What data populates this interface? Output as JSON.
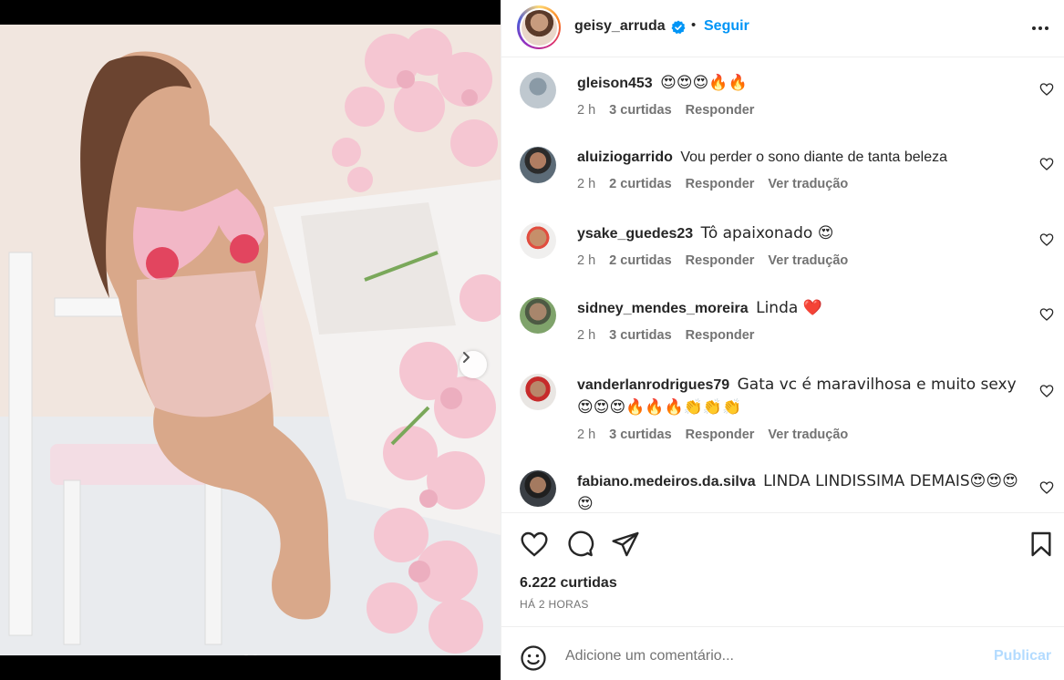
{
  "post": {
    "username": "geisy_arruda",
    "follow_label": "Seguir",
    "separator": "•",
    "likes": "6.222 curtidas",
    "time": "HÁ 2 HORAS"
  },
  "comments": [
    {
      "user": "gleison453",
      "text": "😍😍😍🔥🔥",
      "time": "2 h",
      "likes": "3 curtidas",
      "reply": "Responder",
      "translate": ""
    },
    {
      "user": "aluiziogarrido",
      "text": "Vou perder o sono diante de tanta beleza",
      "time": "2 h",
      "likes": "2 curtidas",
      "reply": "Responder",
      "translate": "Ver tradução"
    },
    {
      "user": "ysake_guedes23",
      "text": "Tô apaixonado 😍",
      "time": "2 h",
      "likes": "2 curtidas",
      "reply": "Responder",
      "translate": "Ver tradução"
    },
    {
      "user": "sidney_mendes_moreira",
      "text": "Linda ❤️",
      "time": "2 h",
      "likes": "3 curtidas",
      "reply": "Responder",
      "translate": ""
    },
    {
      "user": "vanderlanrodrigues79",
      "text": "Gata vc é maravilhosa e muito sexy 😍😍😍🔥🔥🔥👏👏👏",
      "time": "2 h",
      "likes": "3 curtidas",
      "reply": "Responder",
      "translate": "Ver tradução"
    },
    {
      "user": "fabiano.medeiros.da.silva",
      "text": "LINDA LINDISSIMA DEMAIS😍😍😍😍",
      "time": "",
      "likes": "",
      "reply": "",
      "translate": ""
    }
  ],
  "composer": {
    "placeholder": "Adicione um comentário...",
    "publish_label": "Publicar"
  },
  "carousel": {
    "current": 1,
    "total": 2
  },
  "colors": {
    "accent": "#0095f6",
    "verified": "#0095f6",
    "heart": "#ed4956",
    "muted": "#737373"
  },
  "icons": [
    "heart-icon",
    "comment-icon",
    "share-icon",
    "bookmark-icon",
    "more-icon",
    "emoji-icon",
    "chevron-right-icon",
    "verified-icon"
  ]
}
